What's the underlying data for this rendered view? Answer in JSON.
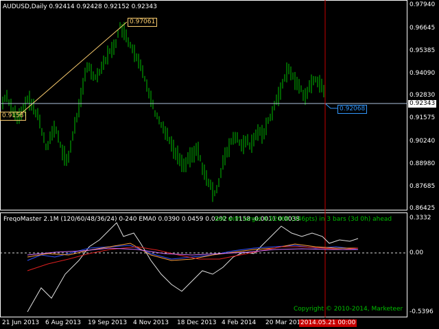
{
  "main_chart": {
    "header": "AUDUSD,Daily  0.92414 0.92428 0.92152 0.92343",
    "price_axis": [
      "0.97940",
      "0.96645",
      "0.95385",
      "0.94090",
      "0.92830",
      "0.91575",
      "0.90240",
      "0.88980",
      "0.87685",
      "0.86425"
    ],
    "current_price": "0.92343",
    "swing_high_label": "0.97061",
    "swing_low_label": "0.9158",
    "target_label": "0.92068",
    "colors": {
      "bars": "#00c000",
      "crosshair": "#c80000",
      "swing_line": "#ffd070",
      "target": "#3399ff"
    }
  },
  "indicator": {
    "header": "FreqoMaster 2.1M  (120/60/48/36/24) 0-240 EMA0 0.0390 0.0459 0.0292 0.1158 -0.0011 0.0038",
    "signal_text": "Sell with target 0.92068 (346pts) in 3 bars (3d 0h) ahead",
    "copyright": "Copyright © 2010-2014, Marketeer",
    "axis": [
      "0.3332",
      "0.00",
      "-0.5396"
    ]
  },
  "time_axis": {
    "labels": [
      "21 Jun 2013",
      "6 Aug 2013",
      "19 Sep 2013",
      "4 Nov 2013",
      "18 Dec 2013",
      "4 Feb 2014",
      "20 Mar 2014"
    ],
    "highlight": "2014.05.21 00:00"
  }
}
